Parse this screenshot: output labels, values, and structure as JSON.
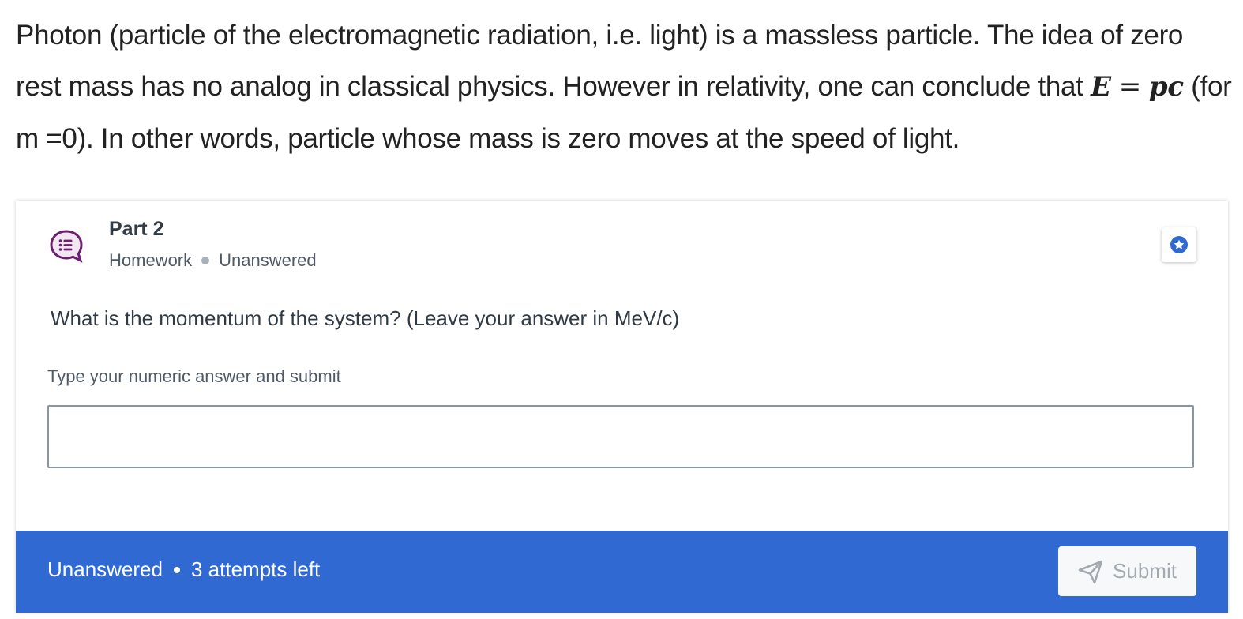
{
  "intro": {
    "text_before_math": "Photon (particle of the electromagnetic radiation, i.e. light) is a massless particle. The idea of zero rest mass has no analog in classical physics. However in relativity, one can conclude that ",
    "math_lhs": "E",
    "math_eq": "=",
    "math_rhs": "pc",
    "text_after_math": " (for m =0). In other words, particle whose mass is zero moves at the speed of light."
  },
  "card": {
    "title": "Part 2",
    "type": "Homework",
    "status": "Unanswered",
    "question": "What is the momentum of the system? (Leave your answer in MeV/c)",
    "input_label": "Type your numeric answer and submit",
    "input_value": "",
    "footer_status": "Unanswered",
    "footer_attempts": "3 attempts left",
    "submit_label": "Submit"
  },
  "icons": {
    "part": "chat-list-icon",
    "star": "star-icon",
    "submit": "send-icon"
  },
  "colors": {
    "accent_blue": "#3169d3",
    "icon_purple": "#6b1f6e"
  }
}
